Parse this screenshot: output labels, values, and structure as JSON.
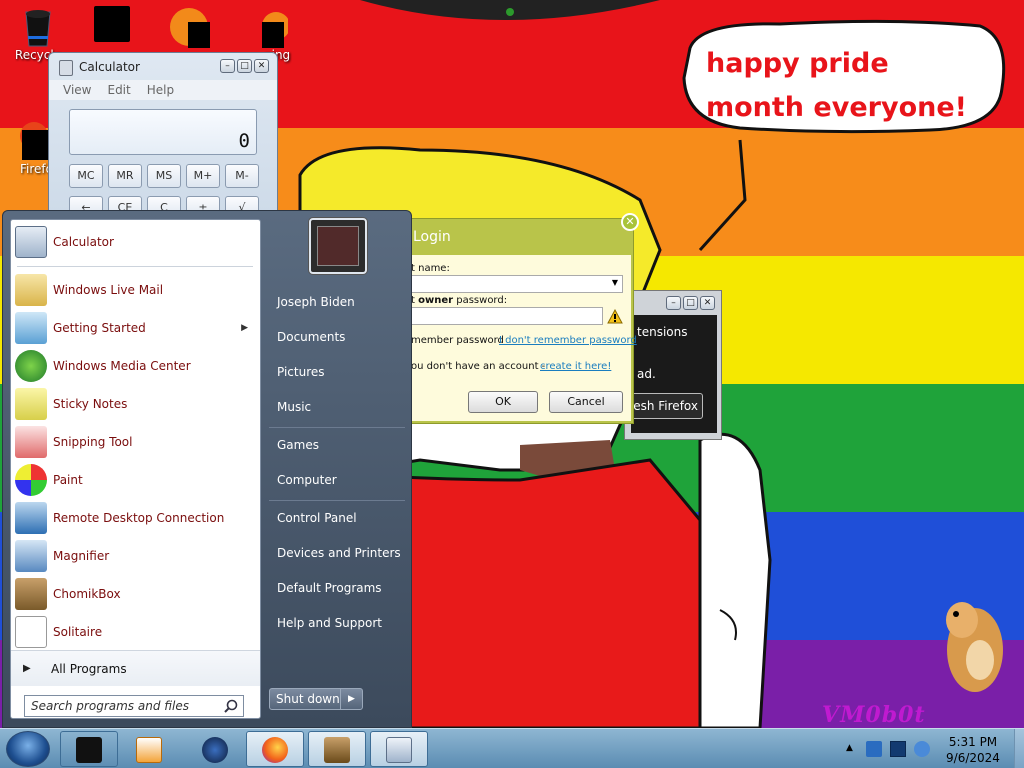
{
  "desktop": {
    "speech_bubble_text": "happy pride month everyone!",
    "watermark": "VM0b0t",
    "icons": [
      {
        "label": "Recycle",
        "icon": "recycle-bin-icon"
      },
      {
        "label": "",
        "icon": "folder-icon"
      },
      {
        "label": "",
        "icon": "firefox-icon"
      },
      {
        "label": "ning",
        "icon": "app-icon"
      },
      {
        "label": "Firefo",
        "icon": "firefox-icon"
      }
    ],
    "stripe_colors": [
      "#e8141a",
      "#f78c1a",
      "#f5e800",
      "#1fa33a",
      "#1f4fd8",
      "#7a1fa8"
    ]
  },
  "calculator": {
    "title": "Calculator",
    "menu": [
      "View",
      "Edit",
      "Help"
    ],
    "display": "0",
    "row1": [
      "MC",
      "MR",
      "MS",
      "M+",
      "M-"
    ],
    "row2": [
      "←",
      "CE",
      "C",
      "±",
      "√"
    ]
  },
  "login_dialog": {
    "title": "Login",
    "account_label": "t name:",
    "password_label_pre": "t ",
    "password_label_bold": "owner",
    "password_label_post": " password:",
    "remember": "member password",
    "forgot_link": "I don't remember password",
    "no_account_text": "ou don't have an account - ",
    "create_link": "create it here!",
    "ok": "OK",
    "cancel": "Cancel",
    "warning_icon": "warning-icon"
  },
  "background_window": {
    "text_extensions": "tensions",
    "text_ad": "ad.",
    "refresh_button": "esh Firefox"
  },
  "start_menu": {
    "programs": [
      {
        "label": "Calculator",
        "icon": "calculator-icon",
        "submenu": false
      },
      {
        "label": "Windows Live Mail",
        "icon": "mail-icon",
        "submenu": false
      },
      {
        "label": "Getting Started",
        "icon": "getting-started-icon",
        "submenu": true
      },
      {
        "label": "Windows Media Center",
        "icon": "media-center-icon",
        "submenu": false
      },
      {
        "label": "Sticky Notes",
        "icon": "sticky-notes-icon",
        "submenu": false
      },
      {
        "label": "Snipping Tool",
        "icon": "scissors-icon",
        "submenu": false
      },
      {
        "label": "Paint",
        "icon": "paint-icon",
        "submenu": false
      },
      {
        "label": "Remote Desktop Connection",
        "icon": "remote-desktop-icon",
        "submenu": false
      },
      {
        "label": "Magnifier",
        "icon": "magnifier-icon",
        "submenu": false
      },
      {
        "label": "ChomikBox",
        "icon": "chomikbox-icon",
        "submenu": false
      },
      {
        "label": "Solitaire",
        "icon": "solitaire-icon",
        "submenu": false
      }
    ],
    "all_programs": "All Programs",
    "search_placeholder": "Search programs and files",
    "right_items": [
      "Joseph Biden",
      "Documents",
      "Pictures",
      "Music",
      "Games",
      "Computer",
      "Control Panel",
      "Devices and Printers",
      "Default Programs",
      "Help and Support"
    ],
    "shutdown": "Shut down"
  },
  "taskbar": {
    "pinned": [
      "explorer-icon",
      "media-player-icon",
      "browser-icon",
      "firefox-icon",
      "chomikbox-icon",
      "calculator-icon"
    ],
    "clock_time": "5:31 PM",
    "clock_date": "9/6/2024"
  }
}
